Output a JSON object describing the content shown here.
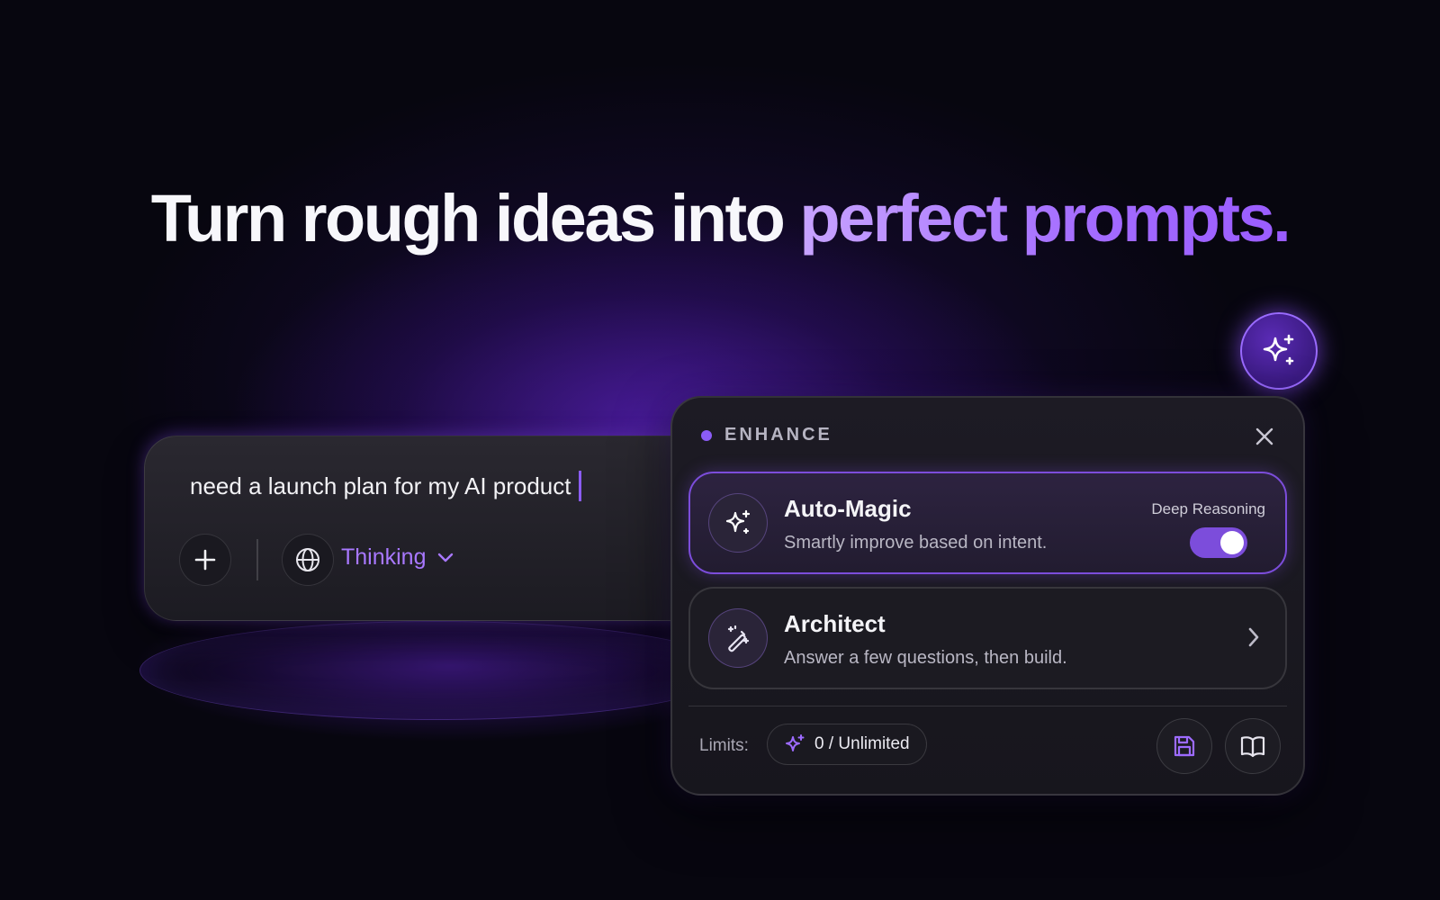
{
  "hero": {
    "headline_main": "Turn rough ideas into",
    "headline_accent": "perfect prompts."
  },
  "composer": {
    "input_value": "need a launch plan for my AI product",
    "mode_label": "Thinking",
    "icons": [
      "plus-icon",
      "globe-icon",
      "chevron-down-icon"
    ]
  },
  "enhance_panel": {
    "title": "ENHANCE",
    "options": [
      {
        "title": "Auto-Magic",
        "description": "Smartly improve based on intent.",
        "toggle_label": "Deep Reasoning",
        "toggle_on": true,
        "icon": "sparkles-icon"
      },
      {
        "title": "Architect",
        "description": "Answer a few questions, then build.",
        "icon": "magic-wand-icon"
      }
    ],
    "footer": {
      "limits_label": "Limits:",
      "limits_value": "0 / Unlimited"
    }
  },
  "colors": {
    "accent": "#8b5cf6",
    "accent_text": "#a878ff",
    "background": "#07060f"
  }
}
